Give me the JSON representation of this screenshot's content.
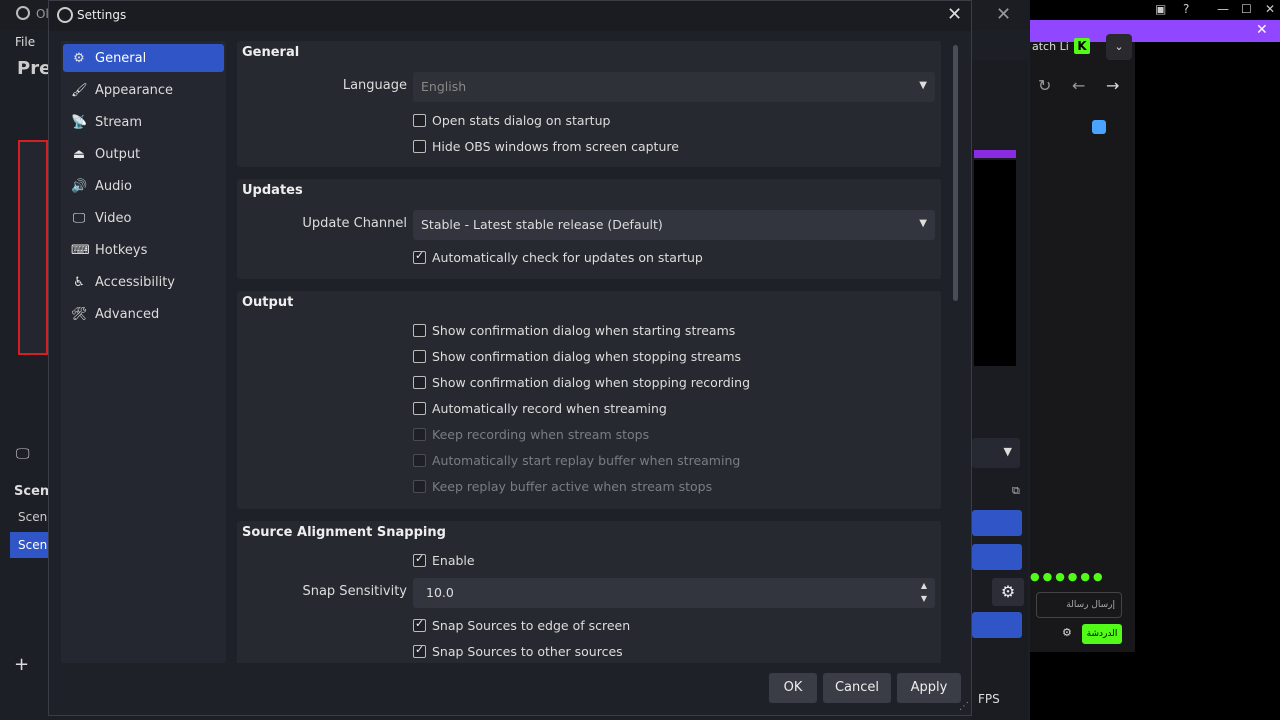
{
  "background_window": {
    "menu_file": "File",
    "preview_title": "Pre",
    "scenes_header": "Scen",
    "scene_items": [
      "Scene",
      "Scen"
    ],
    "add_symbol": "+",
    "fps_text": "FPS",
    "close_symbol": "✕",
    "obs_tab_fragment": "Ol"
  },
  "browser": {
    "tab_text": "atch Li",
    "logo_letter": "K",
    "chat_placeholder": "إرسال رسالة",
    "send_label": "الدردشة",
    "emoji_row": "●●●●●●"
  },
  "settings": {
    "title": "Settings",
    "close_symbol": "✕",
    "sidebar": [
      {
        "label": "General",
        "icon": "gear-icon",
        "glyph": "⚙",
        "active": true
      },
      {
        "label": "Appearance",
        "icon": "appearance-icon",
        "glyph": "🖌",
        "active": false
      },
      {
        "label": "Stream",
        "icon": "antenna-icon",
        "glyph": "📡",
        "active": false
      },
      {
        "label": "Output",
        "icon": "output-icon",
        "glyph": "⏏",
        "active": false
      },
      {
        "label": "Audio",
        "icon": "speaker-icon",
        "glyph": "🔊",
        "active": false
      },
      {
        "label": "Video",
        "icon": "monitor-icon",
        "glyph": "🖵",
        "active": false
      },
      {
        "label": "Hotkeys",
        "icon": "keyboard-icon",
        "glyph": "⌨",
        "active": false
      },
      {
        "label": "Accessibility",
        "icon": "accessibility-icon",
        "glyph": "♿",
        "active": false
      },
      {
        "label": "Advanced",
        "icon": "tools-icon",
        "glyph": "🛠",
        "active": false
      }
    ],
    "general": {
      "title": "General",
      "language_label": "Language",
      "language_value": "English",
      "open_stats": {
        "label": "Open stats dialog on startup",
        "checked": false
      },
      "hide_obs": {
        "label": "Hide OBS windows from screen capture",
        "checked": false
      }
    },
    "updates": {
      "title": "Updates",
      "channel_label": "Update Channel",
      "channel_value": "Stable - Latest stable release (Default)",
      "auto_check": {
        "label": "Automatically check for updates on startup",
        "checked": true
      }
    },
    "output": {
      "title": "Output",
      "options": [
        {
          "label": "Show confirmation dialog when starting streams",
          "checked": false,
          "disabled": false
        },
        {
          "label": "Show confirmation dialog when stopping streams",
          "checked": false,
          "disabled": false
        },
        {
          "label": "Show confirmation dialog when stopping recording",
          "checked": false,
          "disabled": false
        },
        {
          "label": "Automatically record when streaming",
          "checked": false,
          "disabled": false
        },
        {
          "label": "Keep recording when stream stops",
          "checked": false,
          "disabled": true
        },
        {
          "label": "Automatically start replay buffer when streaming",
          "checked": false,
          "disabled": true
        },
        {
          "label": "Keep replay buffer active when stream stops",
          "checked": false,
          "disabled": true
        }
      ]
    },
    "snapping": {
      "title": "Source Alignment Snapping",
      "enable": {
        "label": "Enable",
        "checked": true
      },
      "sensitivity_label": "Snap Sensitivity",
      "sensitivity_value": "10.0",
      "edge": {
        "label": "Snap Sources to edge of screen",
        "checked": true
      },
      "other": {
        "label": "Snap Sources to other sources",
        "checked": true
      }
    },
    "buttons": {
      "ok": "OK",
      "cancel": "Cancel",
      "apply": "Apply"
    }
  },
  "colors": {
    "accent": "#2f55c7",
    "dialog_bg": "#1f2129",
    "section_bg": "#262930",
    "kick_green": "#53fc18",
    "twitch_purple": "#9146ff"
  }
}
